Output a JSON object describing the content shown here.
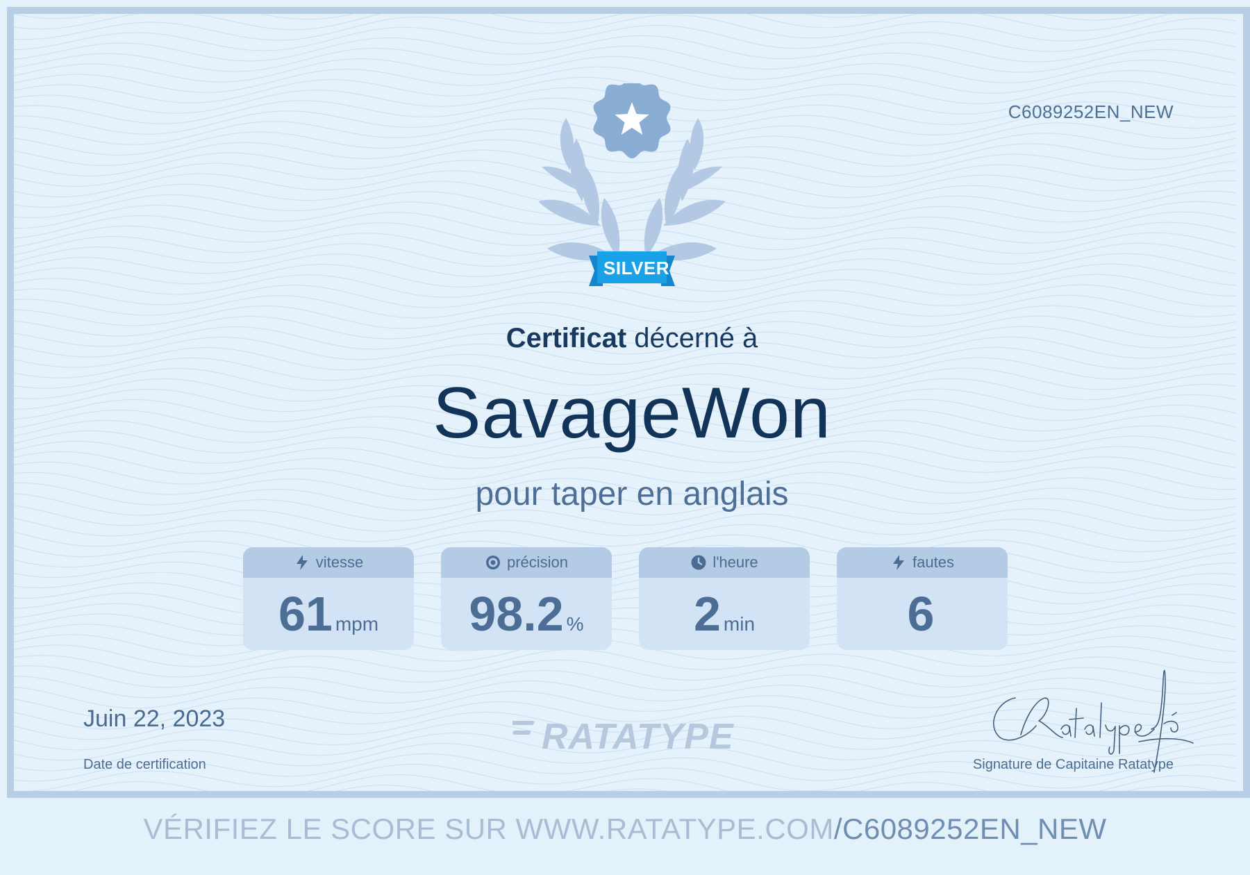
{
  "certificate": {
    "id": "C6089252EN_NEW",
    "level": "SILVER",
    "headline_strong": "Certificat",
    "headline_rest": " décerné à",
    "recipient": "SavageWon",
    "subtitle": "pour taper en anglais"
  },
  "stats": [
    {
      "icon": "lightning-icon",
      "label": "vitesse",
      "value": "61",
      "unit": "mpm"
    },
    {
      "icon": "target-icon",
      "label": "précision",
      "value": "98.2",
      "unit": "%"
    },
    {
      "icon": "clock-icon",
      "label": "l'heure",
      "value": "2",
      "unit": "min"
    },
    {
      "icon": "lightning-icon",
      "label": "fautes",
      "value": "6",
      "unit": ""
    }
  ],
  "footer": {
    "date": "Juin 22, 2023",
    "date_caption": "Date de certification",
    "logo_text": "RATATYPE",
    "signature_caption": "Signature de Capitaine Ratatype"
  },
  "verify": {
    "prefix": "VÉRIFIEZ LE SCORE SUR WWW.RATATYPE.COM",
    "code": "/C6089252EN_NEW"
  },
  "colors": {
    "accent": "#1aa2e8",
    "ink": "#133459",
    "muted": "#4d6e94",
    "frame": "#b8cde6"
  }
}
